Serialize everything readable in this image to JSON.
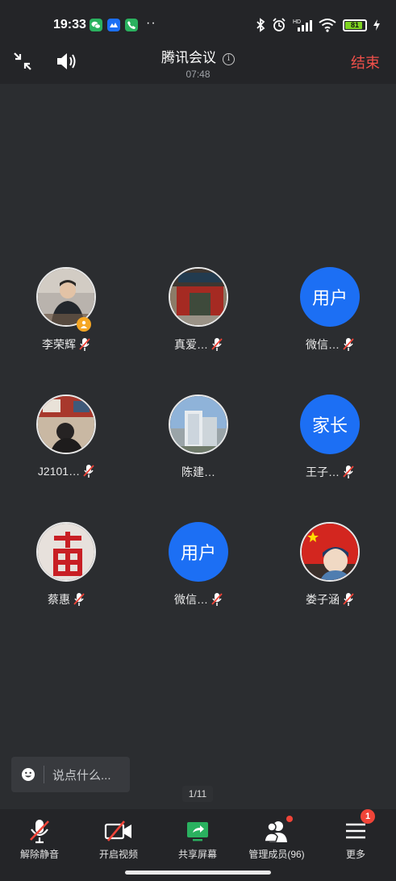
{
  "status_bar": {
    "time": "19:33",
    "battery_level": "81",
    "network_label": "HD"
  },
  "header": {
    "meeting_title": "腾讯会议",
    "timer": "07:48",
    "end_label": "结束"
  },
  "participants": [
    {
      "name": "李荣辉",
      "avatar_type": "photo",
      "is_host": true
    },
    {
      "name": "真爱…",
      "avatar_type": "photo"
    },
    {
      "name": "微信…",
      "avatar_type": "text",
      "avatar_text": "用户"
    },
    {
      "name": "J2101…",
      "avatar_type": "photo"
    },
    {
      "name": "陈建…",
      "avatar_type": "photo"
    },
    {
      "name": "王子…",
      "avatar_type": "text",
      "avatar_text": "家长"
    },
    {
      "name": "蔡惠",
      "avatar_type": "photo"
    },
    {
      "name": "微信…",
      "avatar_type": "text",
      "avatar_text": "用户"
    },
    {
      "name": "娄子涵",
      "avatar_type": "photo"
    }
  ],
  "chat": {
    "placeholder": "说点什么..."
  },
  "pagination": {
    "indicator": "1/11"
  },
  "toolbar": {
    "unmute_label": "解除静音",
    "video_label": "开启视频",
    "share_label": "共享屏幕",
    "members_label": "管理成员(96)",
    "more_label": "更多",
    "more_badge": "1"
  },
  "colors": {
    "background": "#2b2d30",
    "accent_blue": "#1c6ff4",
    "end_red": "#f0504a",
    "share_green": "#2ab15f"
  }
}
